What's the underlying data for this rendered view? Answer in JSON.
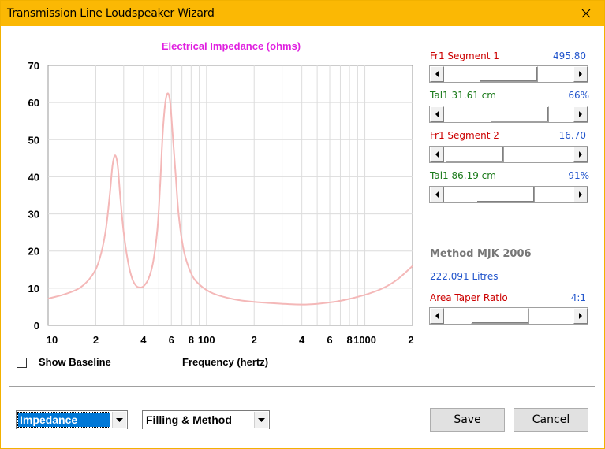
{
  "window": {
    "title": "Transmission Line Loudspeaker Wizard"
  },
  "chart_data": {
    "type": "line",
    "title": "Electrical Impedance (ohms)",
    "xlabel": "Frequency (hertz)",
    "ylabel": "",
    "x_scale": "log",
    "xlim": [
      10,
      2000
    ],
    "ylim": [
      0,
      70
    ],
    "y_ticks": [
      0,
      10,
      20,
      30,
      40,
      50,
      60,
      70
    ],
    "x_tick_labels": [
      {
        "value": 10,
        "label": "10"
      },
      {
        "value": 20,
        "label": "2"
      },
      {
        "value": 40,
        "label": "4"
      },
      {
        "value": 60,
        "label": "6"
      },
      {
        "value": 80,
        "label": "8"
      },
      {
        "value": 100,
        "label": "100"
      },
      {
        "value": 200,
        "label": "2"
      },
      {
        "value": 400,
        "label": "4"
      },
      {
        "value": 600,
        "label": "6"
      },
      {
        "value": 800,
        "label": "8"
      },
      {
        "value": 1000,
        "label": "1000"
      },
      {
        "value": 2000,
        "label": "2"
      }
    ],
    "grid": true,
    "line_color": "#f4b8b8",
    "title_color": "#e020e0",
    "series": [
      {
        "points": [
          [
            10,
            7.2
          ],
          [
            13,
            8.5
          ],
          [
            16,
            10.2
          ],
          [
            19,
            13.5
          ],
          [
            21,
            17.5
          ],
          [
            23,
            25
          ],
          [
            24.5,
            35
          ],
          [
            25.5,
            43
          ],
          [
            26.5,
            45.8
          ],
          [
            27.5,
            43
          ],
          [
            28.5,
            35
          ],
          [
            30,
            25
          ],
          [
            32,
            17
          ],
          [
            34,
            12.5
          ],
          [
            36,
            10.6
          ],
          [
            38,
            10.2
          ],
          [
            40,
            10.5
          ],
          [
            43,
            12.5
          ],
          [
            46,
            17
          ],
          [
            49,
            26
          ],
          [
            51,
            38
          ],
          [
            53,
            52
          ],
          [
            55,
            60
          ],
          [
            57,
            62.5
          ],
          [
            59,
            60
          ],
          [
            61,
            52
          ],
          [
            64,
            40
          ],
          [
            67,
            29
          ],
          [
            72,
            20
          ],
          [
            80,
            14
          ],
          [
            90,
            11
          ],
          [
            110,
            8.6
          ],
          [
            150,
            7
          ],
          [
            200,
            6.3
          ],
          [
            300,
            5.8
          ],
          [
            400,
            5.6
          ],
          [
            500,
            5.8
          ],
          [
            700,
            6.6
          ],
          [
            1000,
            8.2
          ],
          [
            1300,
            10
          ],
          [
            1600,
            12.3
          ],
          [
            2000,
            16
          ]
        ]
      }
    ]
  },
  "controls": {
    "seg1_label": "Fr1  Segment 1",
    "seg1_value": "495.80",
    "seg1_fraction": 0.5,
    "tal1_label": "Tal1  31.61 cm",
    "tal1_value": "66%",
    "tal1_fraction": 0.66,
    "seg2_label": "Fr1  Segment 2",
    "seg2_value": "16.70",
    "seg2_fraction": 0.02,
    "tal2_label": "Tal1  86.19 cm",
    "tal2_value": "91%",
    "tal2_fraction": 0.45,
    "method": "Method MJK 2006",
    "litres": "222.091 Litres",
    "area_taper_label": "Area Taper Ratio",
    "area_taper_value": "4:1",
    "area_taper_fraction": 0.38
  },
  "baseline": {
    "label": "Show Baseline",
    "checked": false
  },
  "footer": {
    "view_select": "Impedance",
    "mode_select": "Filling & Method",
    "save_label": "Save",
    "cancel_label": "Cancel"
  }
}
